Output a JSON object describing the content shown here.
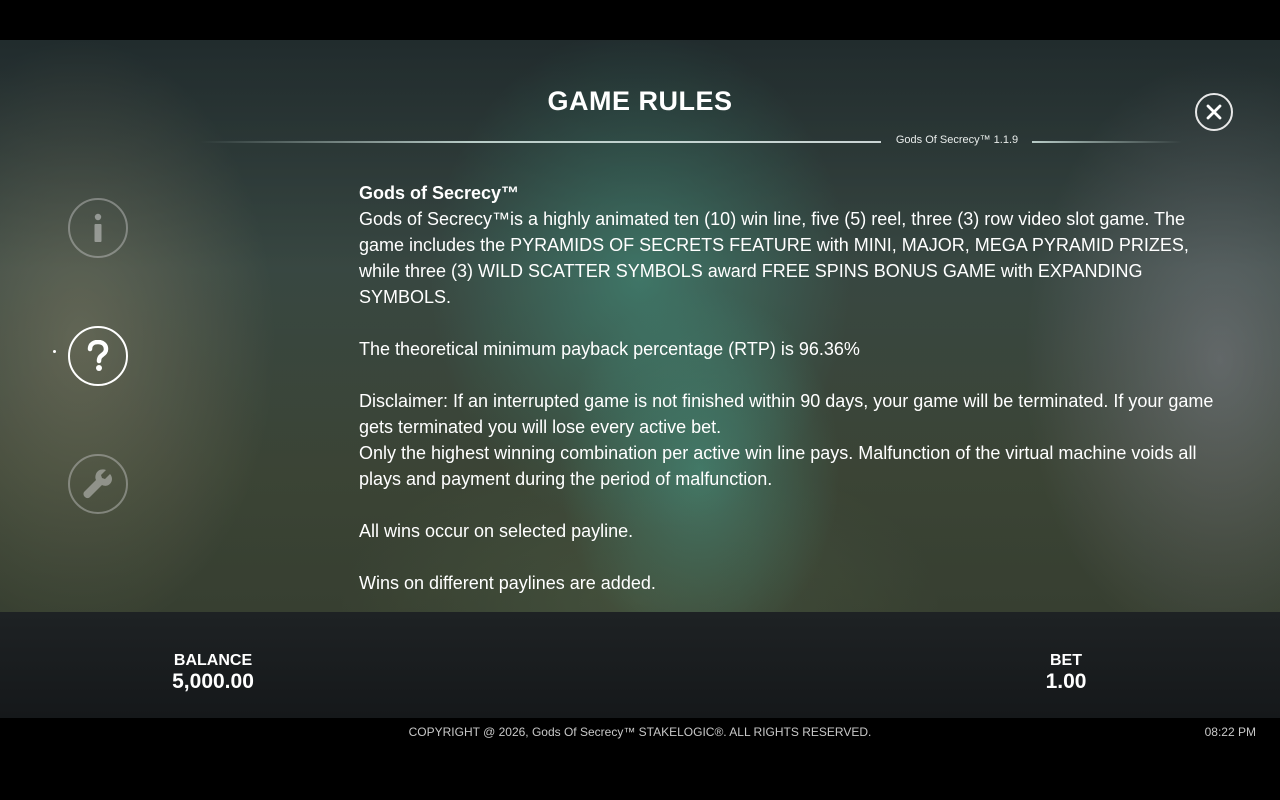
{
  "header": {
    "title": "GAME RULES",
    "version": "Gods Of Secrecy™ 1.1.9",
    "close_label": "X"
  },
  "sidebar": {
    "buttons": [
      {
        "name": "info",
        "icon": "info-icon",
        "active": false
      },
      {
        "name": "help",
        "icon": "question-icon",
        "active": true
      },
      {
        "name": "settings",
        "icon": "wrench-icon",
        "active": false
      }
    ]
  },
  "rules": {
    "heading": "Gods of Secrecy™",
    "intro": "Gods of Secrecy™is a highly animated ten (10) win line, five (5) reel, three (3) row video slot game. The game includes the PYRAMIDS OF SECRETS FEATURE with MINI, MAJOR, MEGA PYRAMID PRIZES, while three (3) WILD SCATTER SYMBOLS award FREE SPINS BONUS GAME with EXPANDING SYMBOLS.",
    "rtp": "The theoretical minimum payback percentage (RTP) is 96.36%",
    "disclaimer_1": "Disclaimer: If an interrupted game is not finished within 90 days, your game will be terminated. If your game gets terminated you will lose every active bet.",
    "disclaimer_2": "Only the highest winning combination per active win line pays. Malfunction of the virtual machine voids all plays and payment during the period of malfunction.",
    "payline": "All wins occur on selected payline.",
    "paylines_added": "Wins on different paylines are added."
  },
  "status": {
    "balance_label": "BALANCE",
    "balance_value": "5,000.00",
    "bet_label": "BET",
    "bet_value": "1.00"
  },
  "footer": {
    "copyright": "COPYRIGHT @ 2026, Gods Of Secrecy™ STAKELOGIC®. ALL RIGHTS RESERVED.",
    "time": "08:22 PM"
  }
}
